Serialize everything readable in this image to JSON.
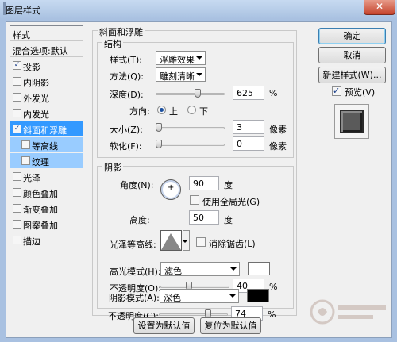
{
  "window": {
    "title": "图层样式",
    "close_symbol": "✕"
  },
  "style_list": {
    "header": "样式",
    "blend_options": "混合选项:默认",
    "items": [
      {
        "label": "投影",
        "checked": true
      },
      {
        "label": "内阴影",
        "checked": false
      },
      {
        "label": "外发光",
        "checked": false
      },
      {
        "label": "内发光",
        "checked": false
      },
      {
        "label": "斜面和浮雕",
        "checked": true,
        "selected": true
      },
      {
        "label": "等高线",
        "checked": false,
        "sub": true
      },
      {
        "label": "纹理",
        "checked": false,
        "sub": true
      },
      {
        "label": "光泽",
        "checked": false
      },
      {
        "label": "颜色叠加",
        "checked": false
      },
      {
        "label": "渐变叠加",
        "checked": false
      },
      {
        "label": "图案叠加",
        "checked": false
      },
      {
        "label": "描边",
        "checked": false
      }
    ]
  },
  "bevel": {
    "section_title": "斜面和浮雕",
    "structure_title": "结构",
    "style_label": "样式(T):",
    "style_value": "浮雕效果",
    "method_label": "方法(Q):",
    "method_value": "雕刻清晰",
    "depth_label": "深度(D):",
    "depth_value": "625",
    "depth_unit": "%",
    "depth_slider_fraction": 0.62,
    "direction_label": "方向:",
    "direction_up": "上",
    "direction_down": "下",
    "direction_selected": "上",
    "size_label": "大小(Z):",
    "size_value": "3",
    "size_unit": "像素",
    "size_slider_fraction": 0.0,
    "soften_label": "软化(F):",
    "soften_value": "0",
    "soften_unit": "像素",
    "soften_slider_fraction": 0.0
  },
  "shading": {
    "title": "阴影",
    "angle_label": "角度(N):",
    "angle_value": "90",
    "angle_unit": "度",
    "global_light_label": "使用全局光(G)",
    "global_light_checked": false,
    "altitude_label": "高度:",
    "altitude_value": "50",
    "altitude_unit": "度",
    "gloss_contour_label": "光泽等高线:",
    "anti_aliased_label": "消除锯齿(L)",
    "anti_aliased_checked": false,
    "highlight_mode_label": "高光模式(H):",
    "highlight_mode_value": "滤色",
    "highlight_color": "#ffffff",
    "highlight_opacity_label": "不透明度(O):",
    "highlight_opacity_value": "40",
    "highlight_opacity_unit": "%",
    "highlight_opacity_fraction": 0.4,
    "shadow_mode_label": "阴影模式(A):",
    "shadow_mode_value": "深色",
    "shadow_color": "#000000",
    "shadow_opacity_label": "不透明度(C):",
    "shadow_opacity_value": "74",
    "shadow_opacity_unit": "%",
    "shadow_opacity_fraction": 0.74
  },
  "footer": {
    "make_default": "设置为默认值",
    "reset_default": "复位为默认值"
  },
  "side_buttons": {
    "ok": "确定",
    "cancel": "取消",
    "new_style": "新建样式(W)...",
    "preview_label": "预览(V)",
    "preview_checked": true
  },
  "icons": {
    "checkmark": "✓",
    "crosshair": "+"
  }
}
